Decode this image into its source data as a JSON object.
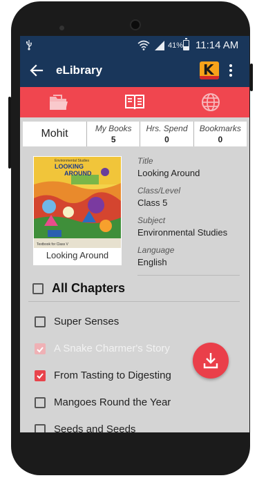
{
  "status_bar": {
    "usb_icon": "usb-icon",
    "battery_percent": "41%",
    "battery_level": 0.41,
    "time": "11:14 AM"
  },
  "app_bar": {
    "title": "eLibrary",
    "logo_letter": "K"
  },
  "tabs": [
    {
      "name": "folder-tab",
      "icon": "folder-open-icon",
      "active": false
    },
    {
      "name": "library-tab",
      "icon": "open-book-icon",
      "active": true
    },
    {
      "name": "globe-tab",
      "icon": "globe-icon",
      "active": false
    }
  ],
  "user_stats": {
    "name": "Mohit",
    "items": [
      {
        "label": "My Books",
        "value": "5"
      },
      {
        "label": "Hrs. Spend",
        "value": "0"
      },
      {
        "label": "Bookmarks",
        "value": "0"
      }
    ]
  },
  "book": {
    "cover_title_line1": "Environmental Studies",
    "cover_title_line2": "LOOKING",
    "cover_title_line3": "AROUND",
    "cover_footer": "Textbook for Class V",
    "caption": "Looking Around",
    "meta": [
      {
        "label": "Title",
        "value": "Looking Around"
      },
      {
        "label": "Class/Level",
        "value": "Class 5"
      },
      {
        "label": "Subject",
        "value": "Environmental Studies"
      },
      {
        "label": "Language",
        "value": "English"
      }
    ]
  },
  "chapters_header": {
    "label": "All Chapters",
    "checked": false
  },
  "chapters": [
    {
      "title": "Super Senses",
      "checked": false,
      "disabled": false
    },
    {
      "title": "A Snake Charmer's Story",
      "checked": true,
      "disabled": true
    },
    {
      "title": "From Tasting to Digesting",
      "checked": true,
      "disabled": false
    },
    {
      "title": "Mangoes Round the Year",
      "checked": false,
      "disabled": false
    },
    {
      "title": "Seeds and Seeds",
      "checked": false,
      "disabled": false
    }
  ],
  "fab": {
    "icon": "download-icon"
  },
  "colors": {
    "primary": "#19365a",
    "accent": "#f0464f",
    "content_bg": "#d4d4d4"
  }
}
